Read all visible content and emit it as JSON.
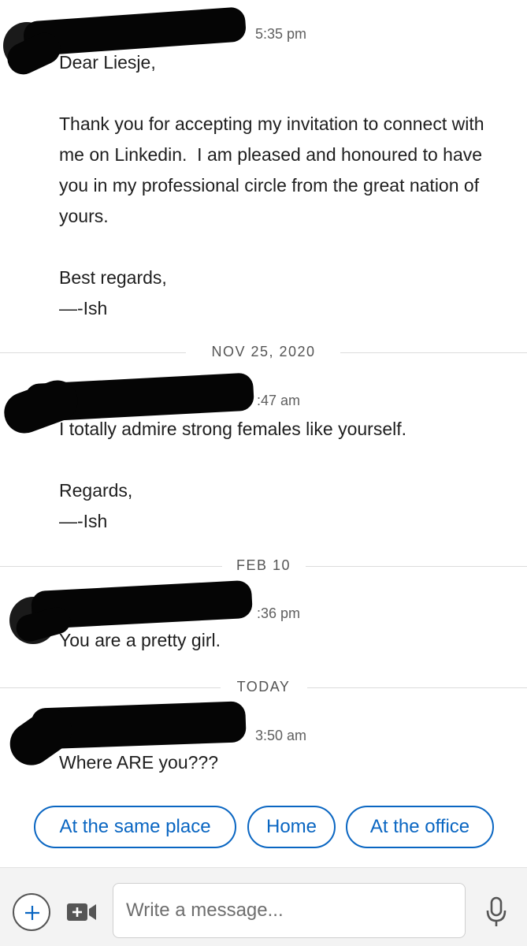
{
  "messages": [
    {
      "time": "5:35 pm",
      "lines": "Dear Liesje,\n\nThank you for accepting my invitation to connect with me on Linkedin.  I am pleased and honoured to have you in my professional circle from the great nation of yours.\n\nBest regards,\n—-Ish"
    },
    {
      "time": ":47 am",
      "lines": "I totally admire strong females like yourself.\n\nRegards,\n—-Ish"
    },
    {
      "time": ":36 pm",
      "lines": "You are a pretty girl."
    },
    {
      "time": "3:50 am",
      "lines": "Where ARE you???"
    }
  ],
  "dividers": [
    "NOV 25, 2020",
    "FEB 10",
    "TODAY"
  ],
  "quick_replies": [
    "At the same place",
    "Home",
    "At the office"
  ],
  "composer": {
    "placeholder": "Write a message...",
    "plus_icon": "plus-icon",
    "video_icon": "video-camera-icon",
    "mic_icon": "microphone-icon"
  },
  "colors": {
    "accent": "#0a66c2",
    "redaction": "#050505",
    "composer_bg": "#f3f3f3"
  }
}
